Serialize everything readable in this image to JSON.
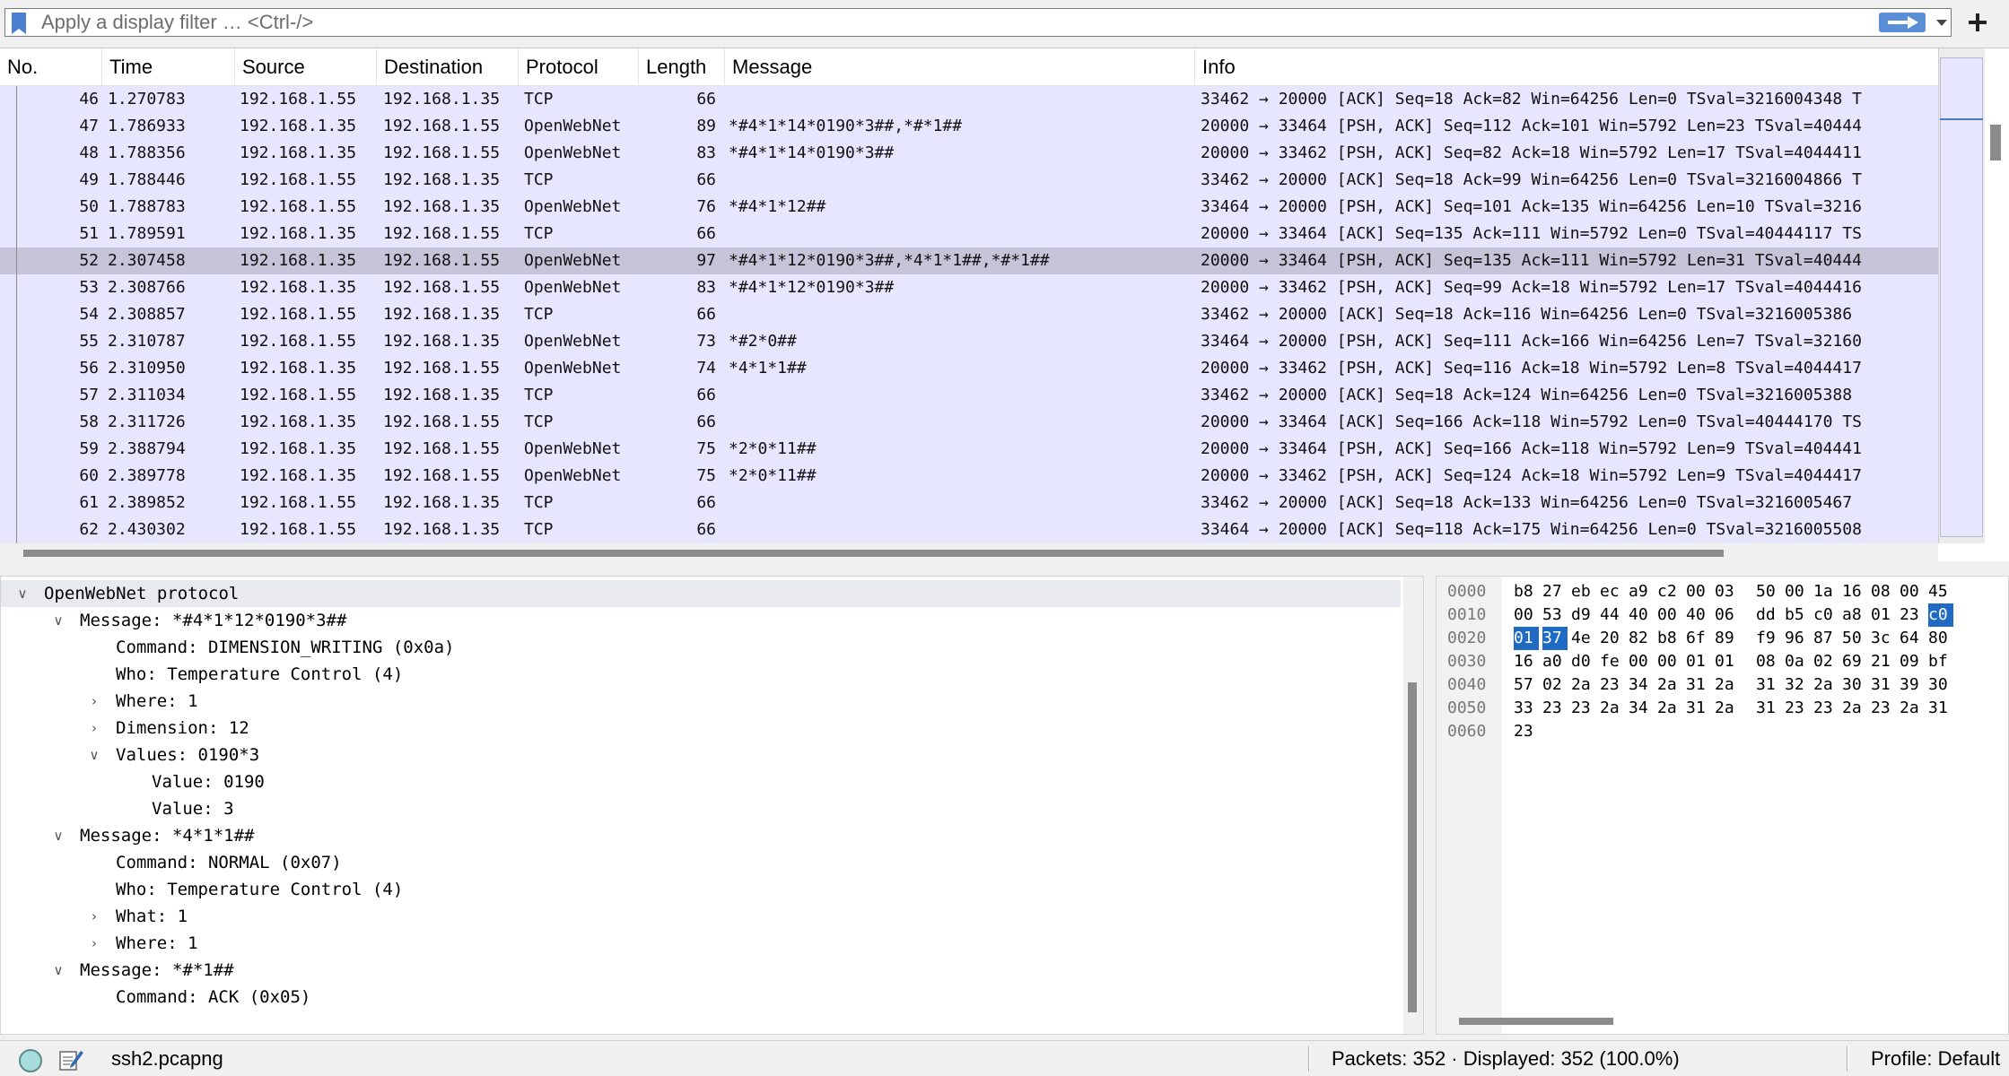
{
  "filter": {
    "placeholder": "Apply a display filter … <Ctrl-/>"
  },
  "packet_list": {
    "columns": [
      "No.",
      "Time",
      "Source",
      "Destination",
      "Protocol",
      "Length",
      "Message",
      "Info"
    ],
    "rows": [
      {
        "no": "46",
        "time": "1.270783",
        "src": "192.168.1.55",
        "dst": "192.168.1.35",
        "proto": "TCP",
        "len": "66",
        "msg": "",
        "info": "33462 → 20000 [ACK] Seq=18 Ack=82 Win=64256 Len=0 TSval=3216004348 T"
      },
      {
        "no": "47",
        "time": "1.786933",
        "src": "192.168.1.35",
        "dst": "192.168.1.55",
        "proto": "OpenWebNet",
        "len": "89",
        "msg": "*#4*1*14*0190*3##,*#*1##",
        "info": "20000 → 33464 [PSH, ACK] Seq=112 Ack=101 Win=5792 Len=23 TSval=40444"
      },
      {
        "no": "48",
        "time": "1.788356",
        "src": "192.168.1.35",
        "dst": "192.168.1.55",
        "proto": "OpenWebNet",
        "len": "83",
        "msg": "*#4*1*14*0190*3##",
        "info": "20000 → 33462 [PSH, ACK] Seq=82 Ack=18 Win=5792 Len=17 TSval=4044411"
      },
      {
        "no": "49",
        "time": "1.788446",
        "src": "192.168.1.55",
        "dst": "192.168.1.35",
        "proto": "TCP",
        "len": "66",
        "msg": "",
        "info": "33462 → 20000 [ACK] Seq=18 Ack=99 Win=64256 Len=0 TSval=3216004866 T"
      },
      {
        "no": "50",
        "time": "1.788783",
        "src": "192.168.1.55",
        "dst": "192.168.1.35",
        "proto": "OpenWebNet",
        "len": "76",
        "msg": "*#4*1*12##",
        "info": "33464 → 20000 [PSH, ACK] Seq=101 Ack=135 Win=64256 Len=10 TSval=3216"
      },
      {
        "no": "51",
        "time": "1.789591",
        "src": "192.168.1.35",
        "dst": "192.168.1.55",
        "proto": "TCP",
        "len": "66",
        "msg": "",
        "info": "20000 → 33464 [ACK] Seq=135 Ack=111 Win=5792 Len=0 TSval=40444117 TS"
      },
      {
        "no": "52",
        "time": "2.307458",
        "src": "192.168.1.35",
        "dst": "192.168.1.55",
        "proto": "OpenWebNet",
        "len": "97",
        "msg": "*#4*1*12*0190*3##,*4*1*1##,*#*1##",
        "info": "20000 → 33464 [PSH, ACK] Seq=135 Ack=111 Win=5792 Len=31 TSval=40444"
      },
      {
        "no": "53",
        "time": "2.308766",
        "src": "192.168.1.35",
        "dst": "192.168.1.55",
        "proto": "OpenWebNet",
        "len": "83",
        "msg": "*#4*1*12*0190*3##",
        "info": "20000 → 33462 [PSH, ACK] Seq=99 Ack=18 Win=5792 Len=17 TSval=4044416"
      },
      {
        "no": "54",
        "time": "2.308857",
        "src": "192.168.1.55",
        "dst": "192.168.1.35",
        "proto": "TCP",
        "len": "66",
        "msg": "",
        "info": "33462 → 20000 [ACK] Seq=18 Ack=116 Win=64256 Len=0 TSval=3216005386"
      },
      {
        "no": "55",
        "time": "2.310787",
        "src": "192.168.1.55",
        "dst": "192.168.1.35",
        "proto": "OpenWebNet",
        "len": "73",
        "msg": "*#2*0##",
        "info": "33464 → 20000 [PSH, ACK] Seq=111 Ack=166 Win=64256 Len=7 TSval=32160"
      },
      {
        "no": "56",
        "time": "2.310950",
        "src": "192.168.1.35",
        "dst": "192.168.1.55",
        "proto": "OpenWebNet",
        "len": "74",
        "msg": "*4*1*1##",
        "info": "20000 → 33462 [PSH, ACK] Seq=116 Ack=18 Win=5792 Len=8 TSval=4044417"
      },
      {
        "no": "57",
        "time": "2.311034",
        "src": "192.168.1.55",
        "dst": "192.168.1.35",
        "proto": "TCP",
        "len": "66",
        "msg": "",
        "info": "33462 → 20000 [ACK] Seq=18 Ack=124 Win=64256 Len=0 TSval=3216005388"
      },
      {
        "no": "58",
        "time": "2.311726",
        "src": "192.168.1.35",
        "dst": "192.168.1.55",
        "proto": "TCP",
        "len": "66",
        "msg": "",
        "info": "20000 → 33464 [ACK] Seq=166 Ack=118 Win=5792 Len=0 TSval=40444170 TS"
      },
      {
        "no": "59",
        "time": "2.388794",
        "src": "192.168.1.35",
        "dst": "192.168.1.55",
        "proto": "OpenWebNet",
        "len": "75",
        "msg": "*2*0*11##",
        "info": "20000 → 33464 [PSH, ACK] Seq=166 Ack=118 Win=5792 Len=9 TSval=404441"
      },
      {
        "no": "60",
        "time": "2.389778",
        "src": "192.168.1.35",
        "dst": "192.168.1.55",
        "proto": "OpenWebNet",
        "len": "75",
        "msg": "*2*0*11##",
        "info": "20000 → 33462 [PSH, ACK] Seq=124 Ack=18 Win=5792 Len=9 TSval=4044417"
      },
      {
        "no": "61",
        "time": "2.389852",
        "src": "192.168.1.55",
        "dst": "192.168.1.35",
        "proto": "TCP",
        "len": "66",
        "msg": "",
        "info": "33462 → 20000 [ACK] Seq=18 Ack=133 Win=64256 Len=0 TSval=3216005467"
      },
      {
        "no": "62",
        "time": "2.430302",
        "src": "192.168.1.55",
        "dst": "192.168.1.35",
        "proto": "TCP",
        "len": "66",
        "msg": "",
        "info": "33464 → 20000 [ACK] Seq=118 Ack=175 Win=64256 Len=0 TSval=3216005508"
      }
    ],
    "selected_no": "52"
  },
  "details": [
    {
      "level": 0,
      "state": "expanded",
      "text": "OpenWebNet protocol"
    },
    {
      "level": 1,
      "state": "expanded",
      "text": "Message: *#4*1*12*0190*3##"
    },
    {
      "level": 2,
      "state": "none",
      "text": "Command: DIMENSION_WRITING (0x0a)"
    },
    {
      "level": 2,
      "state": "none",
      "text": "Who: Temperature Control (4)"
    },
    {
      "level": 2,
      "state": "collapsed",
      "text": "Where: 1"
    },
    {
      "level": 2,
      "state": "collapsed",
      "text": "Dimension: 12"
    },
    {
      "level": 2,
      "state": "expanded",
      "text": "Values: 0190*3"
    },
    {
      "level": 3,
      "state": "none",
      "text": "Value: 0190"
    },
    {
      "level": 3,
      "state": "none",
      "text": "Value: 3"
    },
    {
      "level": 1,
      "state": "expanded",
      "text": "Message: *4*1*1##"
    },
    {
      "level": 2,
      "state": "none",
      "text": "Command: NORMAL (0x07)"
    },
    {
      "level": 2,
      "state": "none",
      "text": "Who: Temperature Control (4)"
    },
    {
      "level": 2,
      "state": "collapsed",
      "text": "What: 1"
    },
    {
      "level": 2,
      "state": "collapsed",
      "text": "Where: 1"
    },
    {
      "level": 1,
      "state": "expanded",
      "text": "Message: *#*1##"
    },
    {
      "level": 2,
      "state": "none",
      "text": "Command: ACK (0x05)"
    }
  ],
  "hex": {
    "rows": [
      {
        "offset": "0000",
        "bytes": [
          "b8",
          "27",
          "eb",
          "ec",
          "a9",
          "c2",
          "00",
          "03",
          "50",
          "00",
          "1a",
          "16",
          "08",
          "00",
          "45"
        ]
      },
      {
        "offset": "0010",
        "bytes": [
          "00",
          "53",
          "d9",
          "44",
          "40",
          "00",
          "40",
          "06",
          "dd",
          "b5",
          "c0",
          "a8",
          "01",
          "23",
          "c0"
        ]
      },
      {
        "offset": "0020",
        "bytes": [
          "01",
          "37",
          "4e",
          "20",
          "82",
          "b8",
          "6f",
          "89",
          "f9",
          "96",
          "87",
          "50",
          "3c",
          "64",
          "80"
        ]
      },
      {
        "offset": "0030",
        "bytes": [
          "16",
          "a0",
          "d0",
          "fe",
          "00",
          "00",
          "01",
          "01",
          "08",
          "0a",
          "02",
          "69",
          "21",
          "09",
          "bf"
        ]
      },
      {
        "offset": "0040",
        "bytes": [
          "57",
          "02",
          "2a",
          "23",
          "34",
          "2a",
          "31",
          "2a",
          "31",
          "32",
          "2a",
          "30",
          "31",
          "39",
          "30"
        ]
      },
      {
        "offset": "0050",
        "bytes": [
          "33",
          "23",
          "23",
          "2a",
          "34",
          "2a",
          "31",
          "2a",
          "31",
          "23",
          "23",
          "2a",
          "23",
          "2a",
          "31"
        ]
      },
      {
        "offset": "0060",
        "bytes": [
          "23"
        ]
      }
    ]
  },
  "status": {
    "file": "ssh2.pcapng",
    "packets": "Packets: 352 · Displayed: 352 (100.0%)",
    "profile": "Profile: Default"
  }
}
